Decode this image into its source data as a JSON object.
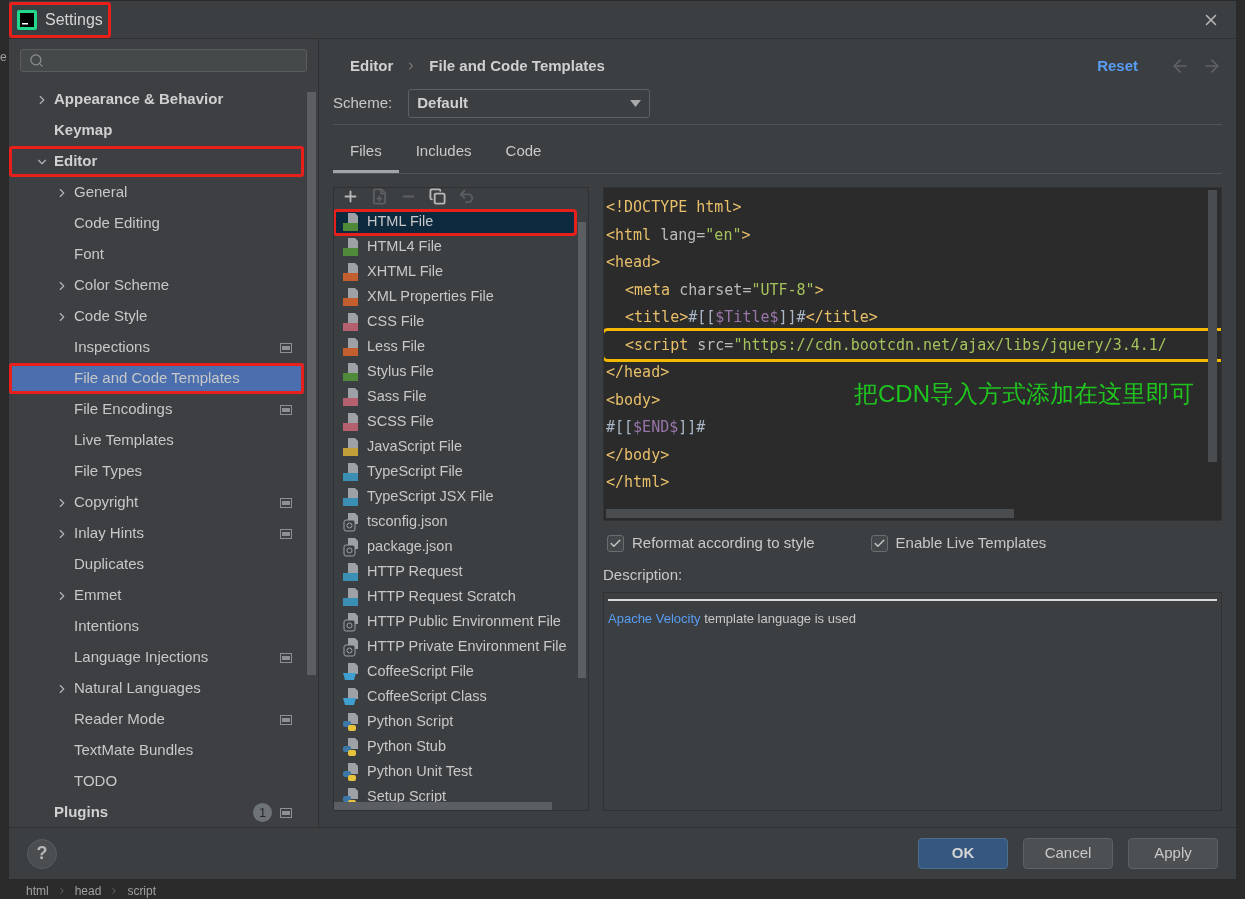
{
  "background": {
    "fragment": "e",
    "breadcrumbs": [
      "html",
      "head",
      "script"
    ]
  },
  "window": {
    "title": "Settings",
    "annotated": true
  },
  "sidebar": {
    "items": [
      {
        "label": "Appearance & Behavior",
        "expanded": false,
        "selected": false,
        "annotated": false,
        "project_scope": false
      },
      {
        "label": "Keymap",
        "selected": false,
        "annotated": false,
        "project_scope": false
      },
      {
        "label": "Editor",
        "expanded": true,
        "selected": false,
        "annotated": true,
        "project_scope": false,
        "children": [
          {
            "label": "General",
            "expanded": false,
            "selected": false,
            "annotated": false,
            "project_scope": false
          },
          {
            "label": "Code Editing",
            "selected": false,
            "annotated": false,
            "project_scope": false
          },
          {
            "label": "Font",
            "selected": false,
            "annotated": false,
            "project_scope": false
          },
          {
            "label": "Color Scheme",
            "expanded": false,
            "selected": false,
            "annotated": false,
            "project_scope": false
          },
          {
            "label": "Code Style",
            "expanded": false,
            "selected": false,
            "annotated": false,
            "project_scope": false
          },
          {
            "label": "Inspections",
            "selected": false,
            "annotated": false,
            "project_scope": true
          },
          {
            "label": "File and Code Templates",
            "selected": true,
            "annotated": true,
            "project_scope": false
          },
          {
            "label": "File Encodings",
            "selected": false,
            "annotated": false,
            "project_scope": true
          },
          {
            "label": "Live Templates",
            "selected": false,
            "annotated": false,
            "project_scope": false
          },
          {
            "label": "File Types",
            "selected": false,
            "annotated": false,
            "project_scope": false
          },
          {
            "label": "Copyright",
            "expanded": false,
            "selected": false,
            "annotated": false,
            "project_scope": true
          },
          {
            "label": "Inlay Hints",
            "expanded": false,
            "selected": false,
            "annotated": false,
            "project_scope": true
          },
          {
            "label": "Duplicates",
            "selected": false,
            "annotated": false,
            "project_scope": false
          },
          {
            "label": "Emmet",
            "expanded": false,
            "selected": false,
            "annotated": false,
            "project_scope": false
          },
          {
            "label": "Intentions",
            "selected": false,
            "annotated": false,
            "project_scope": false
          },
          {
            "label": "Language Injections",
            "selected": false,
            "annotated": false,
            "project_scope": true
          },
          {
            "label": "Natural Languages",
            "expanded": false,
            "selected": false,
            "annotated": false,
            "project_scope": false
          },
          {
            "label": "Reader Mode",
            "selected": false,
            "annotated": false,
            "project_scope": true
          },
          {
            "label": "TextMate Bundles",
            "selected": false,
            "annotated": false,
            "project_scope": false
          },
          {
            "label": "TODO",
            "selected": false,
            "annotated": false,
            "project_scope": false
          }
        ]
      },
      {
        "label": "Plugins",
        "badge": "1",
        "selected": false,
        "annotated": false,
        "project_scope": true
      }
    ]
  },
  "breadcrumb": [
    "Editor",
    "File and Code Templates"
  ],
  "reset_link": "Reset",
  "scheme": {
    "label": "Scheme:",
    "value": "Default"
  },
  "tabs": [
    {
      "label": "Files",
      "selected": true
    },
    {
      "label": "Includes",
      "selected": false
    },
    {
      "label": "Code",
      "selected": false
    }
  ],
  "toolbar": [
    {
      "kind": "add",
      "disabled": false
    },
    {
      "kind": "add-child",
      "disabled": true
    },
    {
      "kind": "remove",
      "disabled": true
    },
    {
      "kind": "copy",
      "disabled": false
    },
    {
      "kind": "reset",
      "disabled": true
    }
  ],
  "templates": [
    {
      "label": "HTML File",
      "kind": "html",
      "selected": true,
      "annotated": true
    },
    {
      "label": "HTML4 File",
      "kind": "html",
      "selected": false,
      "annotated": false
    },
    {
      "label": "XHTML File",
      "kind": "xhtml",
      "selected": false,
      "annotated": false
    },
    {
      "label": "XML Properties File",
      "kind": "xhtml",
      "selected": false,
      "annotated": false
    },
    {
      "label": "CSS File",
      "kind": "css",
      "selected": false,
      "annotated": false
    },
    {
      "label": "Less File",
      "kind": "xhtml",
      "selected": false,
      "annotated": false
    },
    {
      "label": "Stylus File",
      "kind": "html",
      "selected": false,
      "annotated": false
    },
    {
      "label": "Sass File",
      "kind": "css",
      "selected": false,
      "annotated": false
    },
    {
      "label": "SCSS File",
      "kind": "css",
      "selected": false,
      "annotated": false
    },
    {
      "label": "JavaScript File",
      "kind": "js",
      "selected": false,
      "annotated": false
    },
    {
      "label": "TypeScript File",
      "kind": "ts",
      "selected": false,
      "annotated": false
    },
    {
      "label": "TypeScript JSX File",
      "kind": "ts",
      "selected": false,
      "annotated": false
    },
    {
      "label": "tsconfig.json",
      "kind": "json",
      "selected": false,
      "annotated": false
    },
    {
      "label": "package.json",
      "kind": "json",
      "selected": false,
      "annotated": false
    },
    {
      "label": "HTTP Request",
      "kind": "ts",
      "selected": false,
      "annotated": false
    },
    {
      "label": "HTTP Request Scratch",
      "kind": "ts",
      "selected": false,
      "annotated": false
    },
    {
      "label": "HTTP Public Environment File",
      "kind": "json",
      "selected": false,
      "annotated": false
    },
    {
      "label": "HTTP Private Environment File",
      "kind": "json",
      "selected": false,
      "annotated": false
    },
    {
      "label": "CoffeeScript File",
      "kind": "coffee",
      "selected": false,
      "annotated": false
    },
    {
      "label": "CoffeeScript Class",
      "kind": "coffee",
      "selected": false,
      "annotated": false
    },
    {
      "label": "Python Script",
      "kind": "python",
      "selected": false,
      "annotated": false
    },
    {
      "label": "Python Stub",
      "kind": "python",
      "selected": false,
      "annotated": false
    },
    {
      "label": "Python Unit Test",
      "kind": "python",
      "selected": false,
      "annotated": false
    },
    {
      "label": "Setup Script",
      "kind": "python",
      "selected": false,
      "annotated": false
    }
  ],
  "code": {
    "lines": [
      {
        "indent": false,
        "annotated": false,
        "tokens": [
          {
            "kind": "tag",
            "text": "<!DOCTYPE html>"
          }
        ]
      },
      {
        "indent": false,
        "annotated": false,
        "tokens": [
          {
            "kind": "tag",
            "text": "<html"
          },
          {
            "kind": "attr",
            "text": " lang="
          },
          {
            "kind": "string",
            "text": "\"en\""
          },
          {
            "kind": "tag",
            "text": ">"
          }
        ]
      },
      {
        "indent": false,
        "annotated": false,
        "tokens": [
          {
            "kind": "tag",
            "text": "<head>"
          }
        ]
      },
      {
        "indent": true,
        "annotated": false,
        "tokens": [
          {
            "kind": "tag",
            "text": "<meta"
          },
          {
            "kind": "attr",
            "text": " charset="
          },
          {
            "kind": "string",
            "text": "\"UTF-8\""
          },
          {
            "kind": "tag",
            "text": ">"
          }
        ]
      },
      {
        "indent": true,
        "annotated": false,
        "tokens": [
          {
            "kind": "tag",
            "text": "<title>"
          },
          {
            "kind": "text",
            "text": "#[["
          },
          {
            "kind": "var",
            "text": "$Title$"
          },
          {
            "kind": "text",
            "text": "]]#"
          },
          {
            "kind": "tag",
            "text": "</title>"
          }
        ]
      },
      {
        "indent": true,
        "annotated": true,
        "tokens": [
          {
            "kind": "tag",
            "text": "<script"
          },
          {
            "kind": "attr",
            "text": " src="
          },
          {
            "kind": "string",
            "text": "\"https://cdn.bootcdn.net/ajax/libs/jquery/3.4.1/"
          }
        ]
      },
      {
        "indent": false,
        "annotated": false,
        "tokens": [
          {
            "kind": "tag",
            "text": "</head>"
          }
        ]
      },
      {
        "indent": false,
        "annotated": false,
        "tokens": [
          {
            "kind": "tag",
            "text": "<body>"
          }
        ]
      },
      {
        "indent": false,
        "annotated": false,
        "tokens": [
          {
            "kind": "text",
            "text": "#[["
          },
          {
            "kind": "var",
            "text": "$END$"
          },
          {
            "kind": "text",
            "text": "]]#"
          }
        ]
      },
      {
        "indent": false,
        "annotated": false,
        "tokens": [
          {
            "kind": "tag",
            "text": "</body>"
          }
        ]
      },
      {
        "indent": false,
        "annotated": false,
        "tokens": [
          {
            "kind": "tag",
            "text": "</html>"
          }
        ]
      }
    ],
    "note": "把CDN导入方式添加在这里即可"
  },
  "options": [
    {
      "label": "Reformat according to style",
      "checked": true
    },
    {
      "label": "Enable Live Templates",
      "checked": true
    }
  ],
  "description": {
    "label": "Description:",
    "link": "Apache Velocity",
    "text": " template language is used"
  },
  "help_button": "?",
  "buttons": [
    {
      "label": "OK",
      "kind": "primary"
    },
    {
      "label": "Cancel",
      "kind": "normal"
    },
    {
      "label": "Apply",
      "kind": "normal"
    }
  ]
}
